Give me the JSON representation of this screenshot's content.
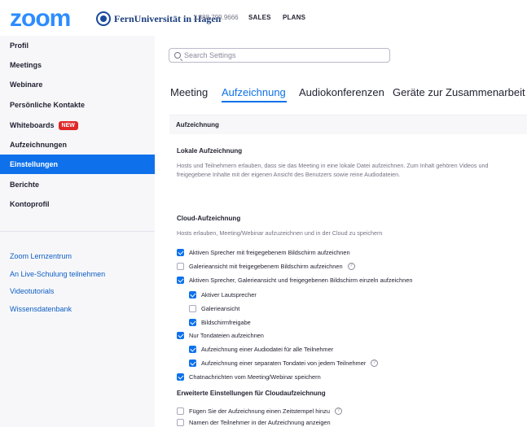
{
  "header": {
    "logo": "zoom",
    "partner_name": "FernUniversität in Hagen",
    "phone": "1.888.799.9666",
    "sales": "SALES",
    "plans": "PLANS"
  },
  "sidebar": {
    "items": [
      {
        "label": "Profil"
      },
      {
        "label": "Meetings"
      },
      {
        "label": "Webinare"
      },
      {
        "label": "Persönliche Kontakte"
      },
      {
        "label": "Whiteboards",
        "badge": "NEW"
      },
      {
        "label": "Aufzeichnungen"
      },
      {
        "label": "Einstellungen"
      },
      {
        "label": "Berichte"
      },
      {
        "label": "Kontoprofil"
      }
    ],
    "links": [
      {
        "label": "Zoom Lernzentrum"
      },
      {
        "label": "An Live-Schulung teilnehmen"
      },
      {
        "label": "Videotutorials"
      },
      {
        "label": "Wissensdatenbank"
      }
    ]
  },
  "search": {
    "placeholder": "Search Settings"
  },
  "tabs": [
    "Meeting",
    "Aufzeichnung",
    "Audiokonferenzen",
    "Geräte zur Zusammenarbeit"
  ],
  "section": {
    "title": "Aufzeichnung"
  },
  "local": {
    "title": "Lokale Aufzeichnung",
    "desc": "Hosts und Teilnehmern erlauben, dass sie das Meeting in eine lokale Datei aufzeichnen. Zum Inhalt gehören Videos und freigegebene Inhalte mit der eigenen Ansicht des Benutzers sowie reine Audiodateien."
  },
  "cloud": {
    "title": "Cloud-Aufzeichnung",
    "desc": "Hosts erlauben, Meeting/Webinar aufzuzeichnen und in der Cloud zu speichern",
    "options": [
      {
        "label": "Aktiven Sprecher mit freigegebenem Bildschirm aufzeichnen",
        "checked": true
      },
      {
        "label": "Galerieansicht mit freigegebenem Bildschirm aufzeichnen",
        "checked": false,
        "help": "?"
      },
      {
        "label": "Aktiven Sprecher, Galerieansicht und freigegebenen Bildschirm einzeln aufzeichnen",
        "checked": true
      },
      {
        "label": "Aktiver Lautsprecher",
        "checked": true
      },
      {
        "label": "Galerieansicht",
        "checked": false
      },
      {
        "label": "Bildschirmfreigabe",
        "checked": true
      },
      {
        "label": "Nur Tondateien aufzeichnen",
        "checked": true
      },
      {
        "label": "Aufzeichnung einer Audiodatei für alle Teilnehmer",
        "checked": true
      },
      {
        "label": "Aufzeichnung einer separaten Tondatei von jedem Teilnehmer",
        "checked": true,
        "help": "?"
      },
      {
        "label": "Chatnachrichten vom Meeting/Webinar speichern",
        "checked": true
      }
    ]
  },
  "advanced": {
    "title": "Erweiterte Einstellungen für Cloudaufzeichnung",
    "options": [
      {
        "label": "Fügen Sie der Aufzeichnung einen Zeitstempel hinzu",
        "checked": false,
        "help": "?"
      },
      {
        "label": "Namen der Teilnehmer in der Aufzeichnung anzeigen",
        "checked": false
      }
    ]
  },
  "colors": {
    "accent": "#0E71EB",
    "brand": "#2D8CFF",
    "badge": "#E02828"
  }
}
